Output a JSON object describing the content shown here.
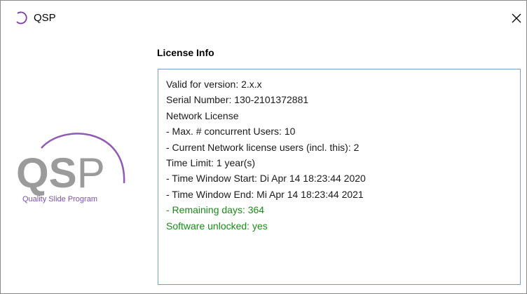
{
  "window": {
    "title": "QSP",
    "close_glyph": "✕"
  },
  "logo": {
    "wordmark_left": "QS",
    "wordmark_right": "P",
    "tagline": "Quality Slide Program",
    "colors": {
      "gray": "#9b9b9b",
      "purple": "#7a3fa0",
      "arc": "#8e5ab3",
      "tagline": "#7a52a8"
    }
  },
  "license": {
    "heading": "License Info",
    "lines": [
      {
        "text": "Valid for version: 2.x.x",
        "color": "#1a1a1a"
      },
      {
        "text": "Serial Number: 130-2101372881",
        "color": "#1a1a1a"
      },
      {
        "text": "Network License",
        "color": "#1a1a1a"
      },
      {
        "text": "- Max. # concurrent Users: 10",
        "color": "#1a1a1a"
      },
      {
        "text": "- Current Network license users (incl. this): 2",
        "color": "#1a1a1a"
      },
      {
        "text": "Time Limit: 1 year(s)",
        "color": "#1a1a1a"
      },
      {
        "text": "- Time Window Start: Di Apr 14 18:23:44 2020",
        "color": "#1a1a1a"
      },
      {
        "text": "- Time Window End: Mi Apr 14 18:23:44 2021",
        "color": "#1a1a1a"
      },
      {
        "text": "- Remaining days: 364",
        "color": "#1a8a1a"
      },
      {
        "text": "Software unlocked: yes",
        "color": "#1a8a1a"
      }
    ]
  }
}
